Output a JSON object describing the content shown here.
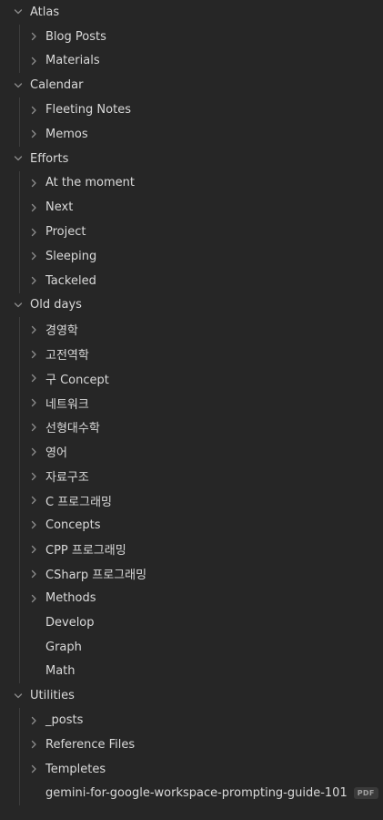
{
  "icons": {
    "expanded": "chevron-down-icon",
    "collapsed": "chevron-right-icon"
  },
  "colors": {
    "background": "#262626",
    "text": "#dadada",
    "icon": "#8c8c8c",
    "guide_line": "#3d3d3d",
    "badge_bg": "#3a3a3a"
  },
  "tree": {
    "atlas": {
      "label": "Atlas",
      "children": [
        "Blog Posts",
        "Materials"
      ]
    },
    "calendar": {
      "label": "Calendar",
      "children": [
        "Fleeting Notes",
        "Memos"
      ]
    },
    "efforts": {
      "label": "Efforts",
      "children": [
        "At the moment",
        "Next",
        "Project",
        "Sleeping",
        "Tackeled"
      ]
    },
    "old_days": {
      "label": "Old days",
      "folders": [
        "경영학",
        "고전역학",
        "구 Concept",
        "네트워크",
        "선형대수학",
        "영어",
        "자료구조",
        "C 프로그래밍",
        "Concepts",
        "CPP 프로그래밍",
        "CSharp 프로그래밍",
        "Methods"
      ],
      "files": [
        "Develop",
        "Graph",
        "Math"
      ]
    },
    "utilities": {
      "label": "Utilities",
      "folders": [
        "_posts",
        "Reference Files",
        "Templetes"
      ],
      "file": {
        "name": "gemini-for-google-workspace-prompting-guide-101",
        "badge": "PDF"
      }
    }
  }
}
